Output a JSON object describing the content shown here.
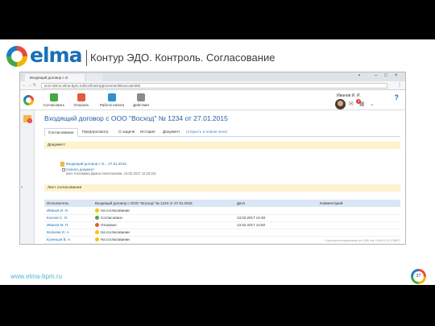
{
  "slide": {
    "logo_text": "elma",
    "title": "Контур ЭДО. Контроль. Согласование",
    "website": "www.elma-bpm.ru",
    "page_number": "27"
  },
  "browser": {
    "tab_title": "Входящий договор с О",
    "url": "ecm-demo.elma-bpm.ru/Docflow/Approvement/Execute/482"
  },
  "toolbar": {
    "buttons": [
      {
        "label": "Согласовать",
        "icon": "approve-icon",
        "color": "#45a843"
      },
      {
        "label": "Отказать",
        "icon": "reject-icon",
        "color": "#e55a3c"
      },
      {
        "label": "Работа начата",
        "icon": "work-started-icon",
        "color": "#2f8fd1"
      },
      {
        "label": "Действия",
        "icon": "actions-icon",
        "color": "#8a8a8a"
      }
    ],
    "user_name": "Иванов И. И.",
    "notifications": "3"
  },
  "sidebar": {
    "badge": "2"
  },
  "document": {
    "title": "Входящий договор с ООО \"Восход\" № 1234 от 27.01.2015",
    "tabs": [
      {
        "label": "Согласование"
      },
      {
        "label": "Предпросмотр"
      },
      {
        "label": "О задаче"
      },
      {
        "label": "История"
      },
      {
        "label": "Документ"
      },
      {
        "label": "(открыть в новом окне)"
      }
    ],
    "section_documents": "Документ:",
    "attachment": "Входящий договор с О... 27.01.2015",
    "download_link": "Скачать документ",
    "version_info": "(вкл. Коломина Диана Анатольевна, 13.02.2017 12:24:24)",
    "section_route": "Лист согласования"
  },
  "route_table": {
    "columns": [
      "Исполнитель",
      "Входящий договор с ООО \"Восход\" № 1234 от 27.01.2015",
      "Дата",
      "Комментарий"
    ],
    "rows": [
      {
        "person": "Иванов И. И.",
        "status": "На согласовании",
        "status_type": "wait",
        "date": "",
        "comment": ""
      },
      {
        "person": "Козлов С. О.",
        "status": "Согласовано",
        "status_type": "ok",
        "date": "13.02.2017 14:48",
        "comment": ""
      },
      {
        "person": "Иванов М. П.",
        "status": "Отказано",
        "status_type": "rej",
        "date": "13.02.2017 14:50",
        "comment": ""
      },
      {
        "person": "Волкова И. А.",
        "status": "На согласовании",
        "status_type": "wait",
        "date": "",
        "comment": ""
      },
      {
        "person": "Кузнецов В. А.",
        "status": "На согласовании",
        "status_type": "wait",
        "date": "",
        "comment": ""
      }
    ]
  },
  "footnote": "Страница сгенерирована за 0,086 сек. ELMA 3.10.9.36817"
}
